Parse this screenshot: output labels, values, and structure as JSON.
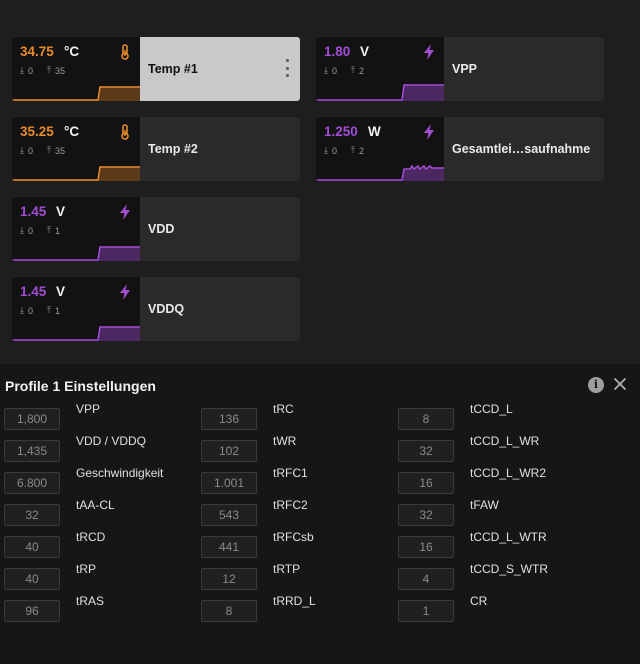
{
  "sensors": [
    {
      "id": "temp1",
      "value": "34.75",
      "unit": "°C",
      "min": "0",
      "max": "35",
      "name": "Temp #1",
      "kind": "temp",
      "color": "#e88a2c",
      "selected": true
    },
    {
      "id": "vpp",
      "value": "1.80",
      "unit": "V",
      "min": "0",
      "max": "2",
      "name": "VPP",
      "kind": "volt",
      "color": "#a24dd6",
      "selected": false
    },
    {
      "id": "temp2",
      "value": "35.25",
      "unit": "°C",
      "min": "0",
      "max": "35",
      "name": "Temp #2",
      "kind": "temp",
      "color": "#e88a2c",
      "selected": false
    },
    {
      "id": "power",
      "value": "1.250",
      "unit": "W",
      "min": "0",
      "max": "2",
      "name": "Gesamtlei…saufnahme",
      "kind": "volt",
      "color": "#a24dd6",
      "selected": false
    },
    {
      "id": "vdd",
      "value": "1.45",
      "unit": "V",
      "min": "0",
      "max": "1",
      "name": "VDD",
      "kind": "volt",
      "color": "#a24dd6",
      "selected": false
    },
    {
      "id": "vddq",
      "value": "1.45",
      "unit": "V",
      "min": "0",
      "max": "1",
      "name": "VDDQ",
      "kind": "volt",
      "color": "#a24dd6",
      "selected": false
    }
  ],
  "profile": {
    "title": "Profile 1 Einstellungen",
    "col1": [
      {
        "value": "1,800",
        "label": "VPP"
      },
      {
        "value": "1,435",
        "label": "VDD / VDDQ"
      },
      {
        "value": "6.800",
        "label": "Geschwindigkeit"
      },
      {
        "value": "32",
        "label": "tAA-CL"
      },
      {
        "value": "40",
        "label": "tRCD"
      },
      {
        "value": "40",
        "label": "tRP"
      },
      {
        "value": "96",
        "label": "tRAS"
      }
    ],
    "col2": [
      {
        "value": "136",
        "label": "tRC"
      },
      {
        "value": "102",
        "label": "tWR"
      },
      {
        "value": "1.001",
        "label": "tRFC1"
      },
      {
        "value": "543",
        "label": "tRFC2"
      },
      {
        "value": "441",
        "label": "tRFCsb"
      },
      {
        "value": "12",
        "label": "tRTP"
      },
      {
        "value": "8",
        "label": "tRRD_L"
      }
    ],
    "col3": [
      {
        "value": "8",
        "label": "tCCD_L"
      },
      {
        "value": "32",
        "label": "tCCD_L_WR"
      },
      {
        "value": "16",
        "label": "tCCD_L_WR2"
      },
      {
        "value": "32",
        "label": "tFAW"
      },
      {
        "value": "16",
        "label": "tCCD_L_WTR"
      },
      {
        "value": "4",
        "label": "tCCD_S_WTR"
      },
      {
        "value": "1",
        "label": "CR"
      }
    ]
  },
  "colors": {
    "temp": "#e88a2c",
    "volt": "#a24dd6",
    "selected": "#c9c9c9"
  }
}
